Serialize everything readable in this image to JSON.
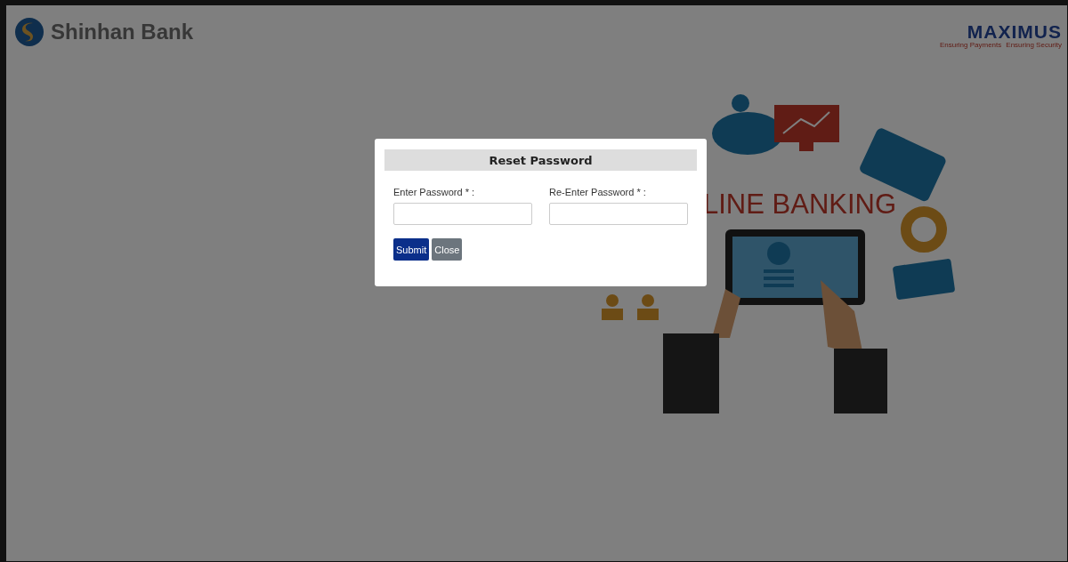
{
  "header": {
    "brand": "Shinhan Bank",
    "partner": {
      "name": "MAXIMUS",
      "taglines": [
        "Ensuring Payments",
        "Ensuring Security"
      ]
    }
  },
  "illustration": {
    "caption": "LINE BANKING"
  },
  "dialog": {
    "title": "Reset Password",
    "fields": [
      {
        "label": "Enter Password * :"
      },
      {
        "label": "Re-Enter Password * :"
      }
    ],
    "buttons": [
      {
        "label": "Submit",
        "kind": "primary"
      },
      {
        "label": "Close",
        "kind": "secondary"
      }
    ]
  }
}
